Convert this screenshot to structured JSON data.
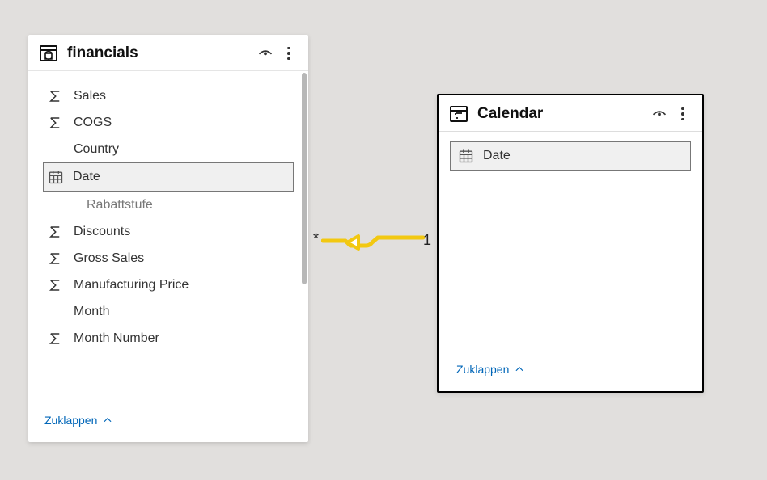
{
  "canvas": {
    "background": "#e1dfdd"
  },
  "relationship": {
    "many_side": "*",
    "one_side": "1",
    "color": "#f2c811"
  },
  "tables": {
    "financials": {
      "title": "financials",
      "collapse_label": "Zuklappen",
      "fields": [
        {
          "name": "Sales",
          "icon": "sigma",
          "selected": false,
          "indent": false
        },
        {
          "name": "COGS",
          "icon": "sigma",
          "selected": false,
          "indent": false
        },
        {
          "name": "Country",
          "icon": "none",
          "selected": false,
          "indent": false
        },
        {
          "name": "Date",
          "icon": "calendar",
          "selected": true,
          "indent": false
        },
        {
          "name": "Rabattstufe",
          "icon": "none",
          "selected": false,
          "indent": true
        },
        {
          "name": "Discounts",
          "icon": "sigma",
          "selected": false,
          "indent": false
        },
        {
          "name": "Gross Sales",
          "icon": "sigma",
          "selected": false,
          "indent": false
        },
        {
          "name": "Manufacturing Price",
          "icon": "sigma",
          "selected": false,
          "indent": false
        },
        {
          "name": "Month",
          "icon": "none",
          "selected": false,
          "indent": false
        },
        {
          "name": "Month Number",
          "icon": "sigma",
          "selected": false,
          "indent": false
        }
      ]
    },
    "calendar": {
      "title": "Calendar",
      "collapse_label": "Zuklappen",
      "fields": [
        {
          "name": "Date",
          "icon": "calendar",
          "selected": true,
          "indent": false
        }
      ]
    }
  }
}
